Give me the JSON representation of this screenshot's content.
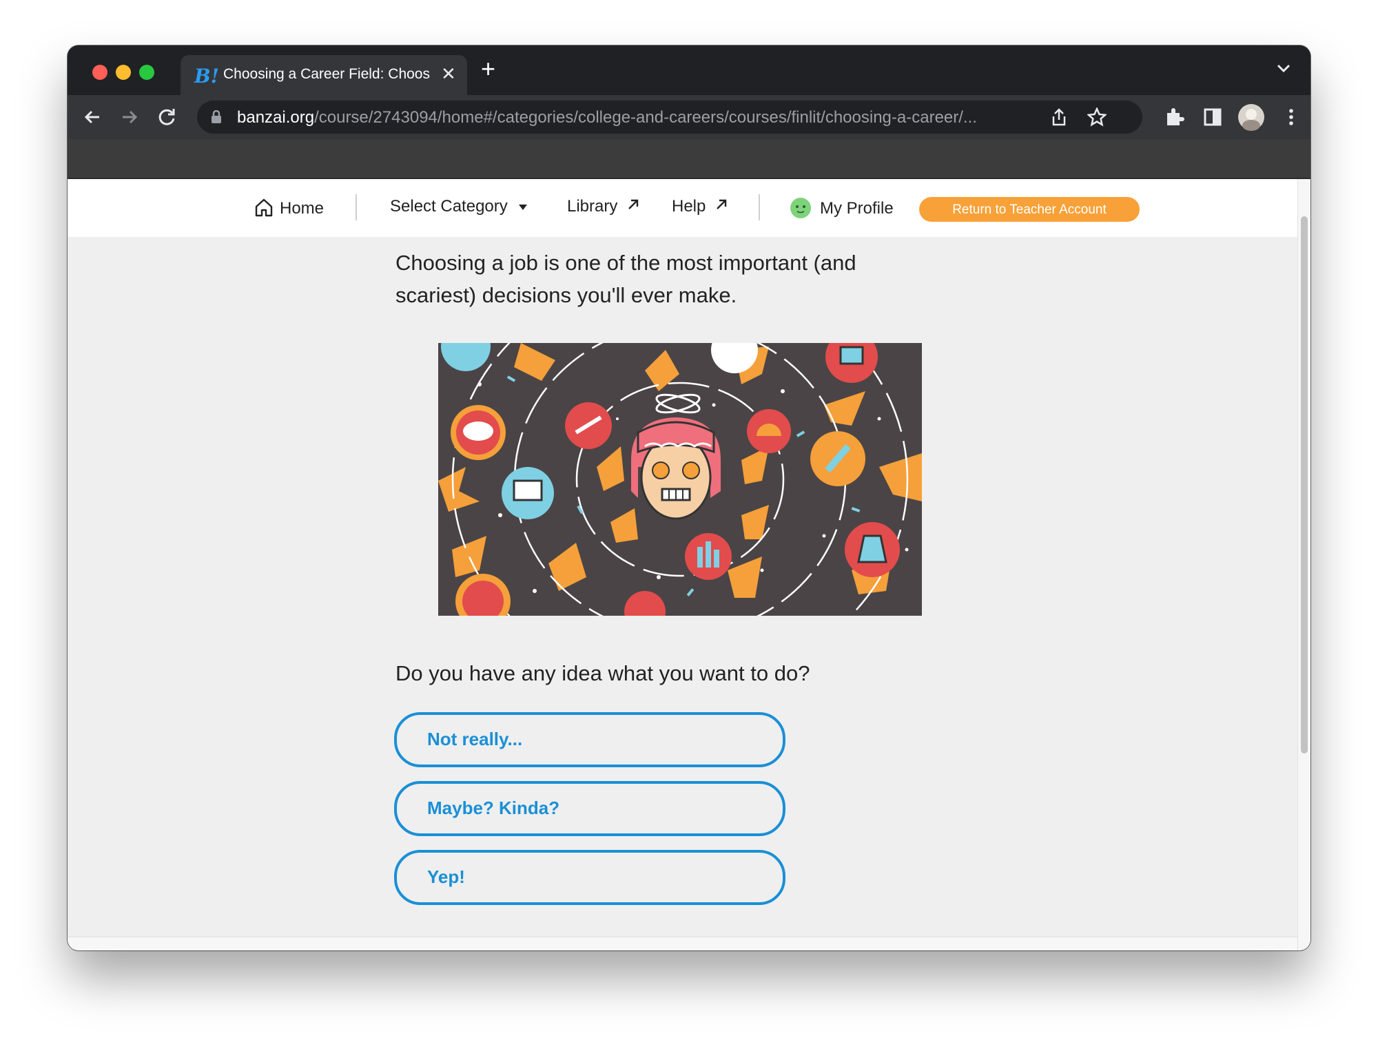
{
  "browser": {
    "tab_title": "Choosing a Career Field: Choos",
    "tab_favicon": "B!",
    "url_host": "banzai.org",
    "url_path": "/course/2743094/home#/categories/college-and-careers/courses/finlit/choosing-a-career/..."
  },
  "nav": {
    "home": "Home",
    "select_category": "Select Category",
    "library": "Library",
    "help": "Help",
    "my_profile": "My Profile",
    "return_button": "Return to Teacher Account"
  },
  "main": {
    "intro_line1": "Choosing a job is one of the most important (and",
    "intro_line2": "scariest) decisions you'll ever make.",
    "question": "Do you have any idea what you want to do?",
    "answers": [
      "Not really...",
      "Maybe? Kinda?",
      "Yep!"
    ]
  },
  "colors": {
    "accent": "#1a8fd6",
    "button_orange": "#f8a138",
    "page_bg": "#efefef"
  }
}
